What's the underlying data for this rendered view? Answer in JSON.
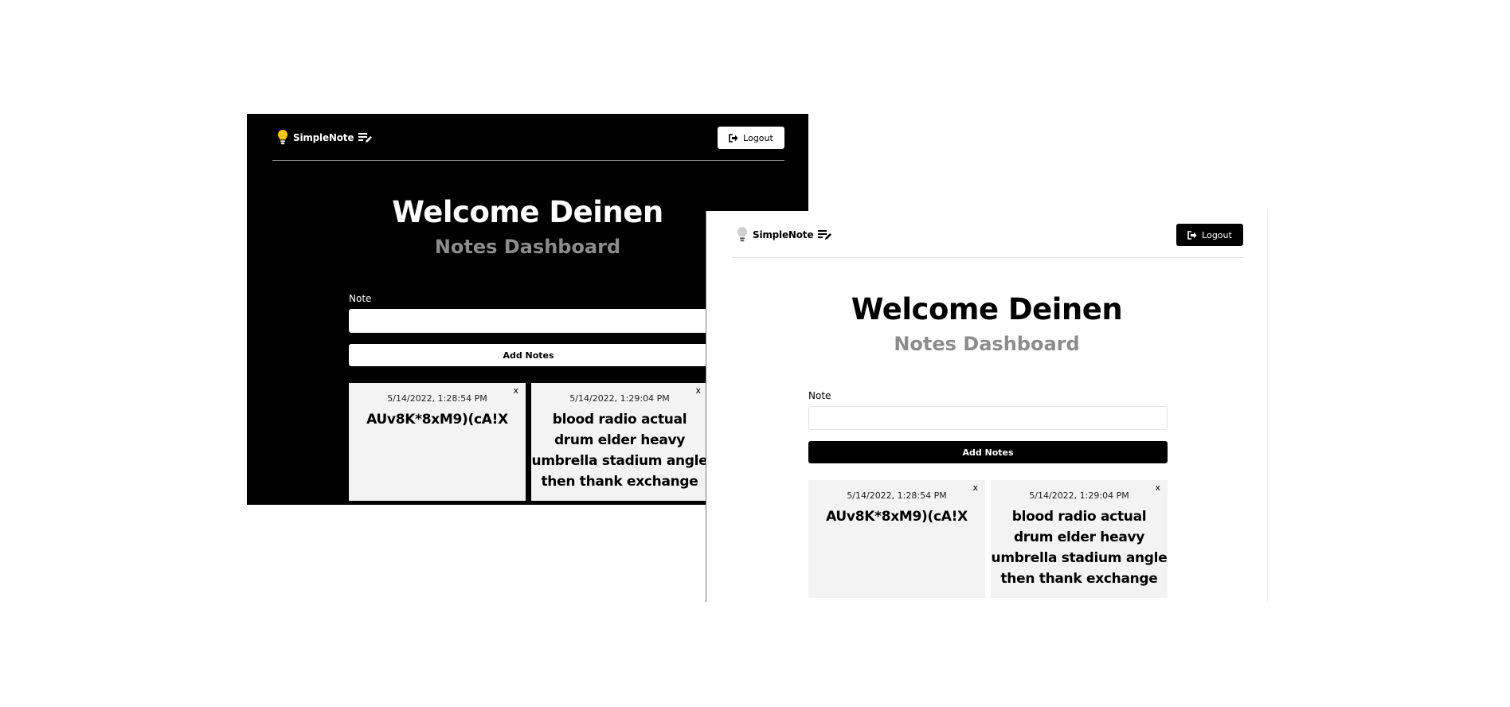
{
  "colors": {
    "dark_bg": "#000000",
    "light_bg": "#ffffff",
    "card_bg": "#f3f3f3",
    "subtitle": "#8c8c8c",
    "bulb_on": "#f5c518",
    "bulb_off": "#d0d0d0"
  },
  "icons": {
    "brand": "lightbulb-icon",
    "brand_suffix": "notes-edit-icon",
    "logout": "logout-icon"
  },
  "dark": {
    "brand": "SimpleNote",
    "logout_label": "Logout",
    "welcome": "Welcome Deinen",
    "subtitle": "Notes Dashboard",
    "note_label": "Note",
    "note_value": "",
    "add_label": "Add Notes",
    "notes": [
      {
        "timestamp": "5/14/2022, 1:28:54 PM",
        "text": "AUv8K*8xM9)(cA!X",
        "delete": "x"
      },
      {
        "timestamp": "5/14/2022, 1:29:04 PM",
        "text": "blood radio actual drum elder heavy umbrella stadium angle then thank exchange",
        "delete": "x"
      }
    ]
  },
  "light": {
    "brand": "SimpleNote",
    "logout_label": "Logout",
    "welcome": "Welcome Deinen",
    "subtitle": "Notes Dashboard",
    "note_label": "Note",
    "note_value": "",
    "add_label": "Add Notes",
    "notes": [
      {
        "timestamp": "5/14/2022, 1:28:54 PM",
        "text": "AUv8K*8xM9)(cA!X",
        "delete": "x"
      },
      {
        "timestamp": "5/14/2022, 1:29:04 PM",
        "text": "blood radio actual drum elder heavy umbrella stadium angle then thank exchange",
        "delete": "x"
      }
    ]
  }
}
